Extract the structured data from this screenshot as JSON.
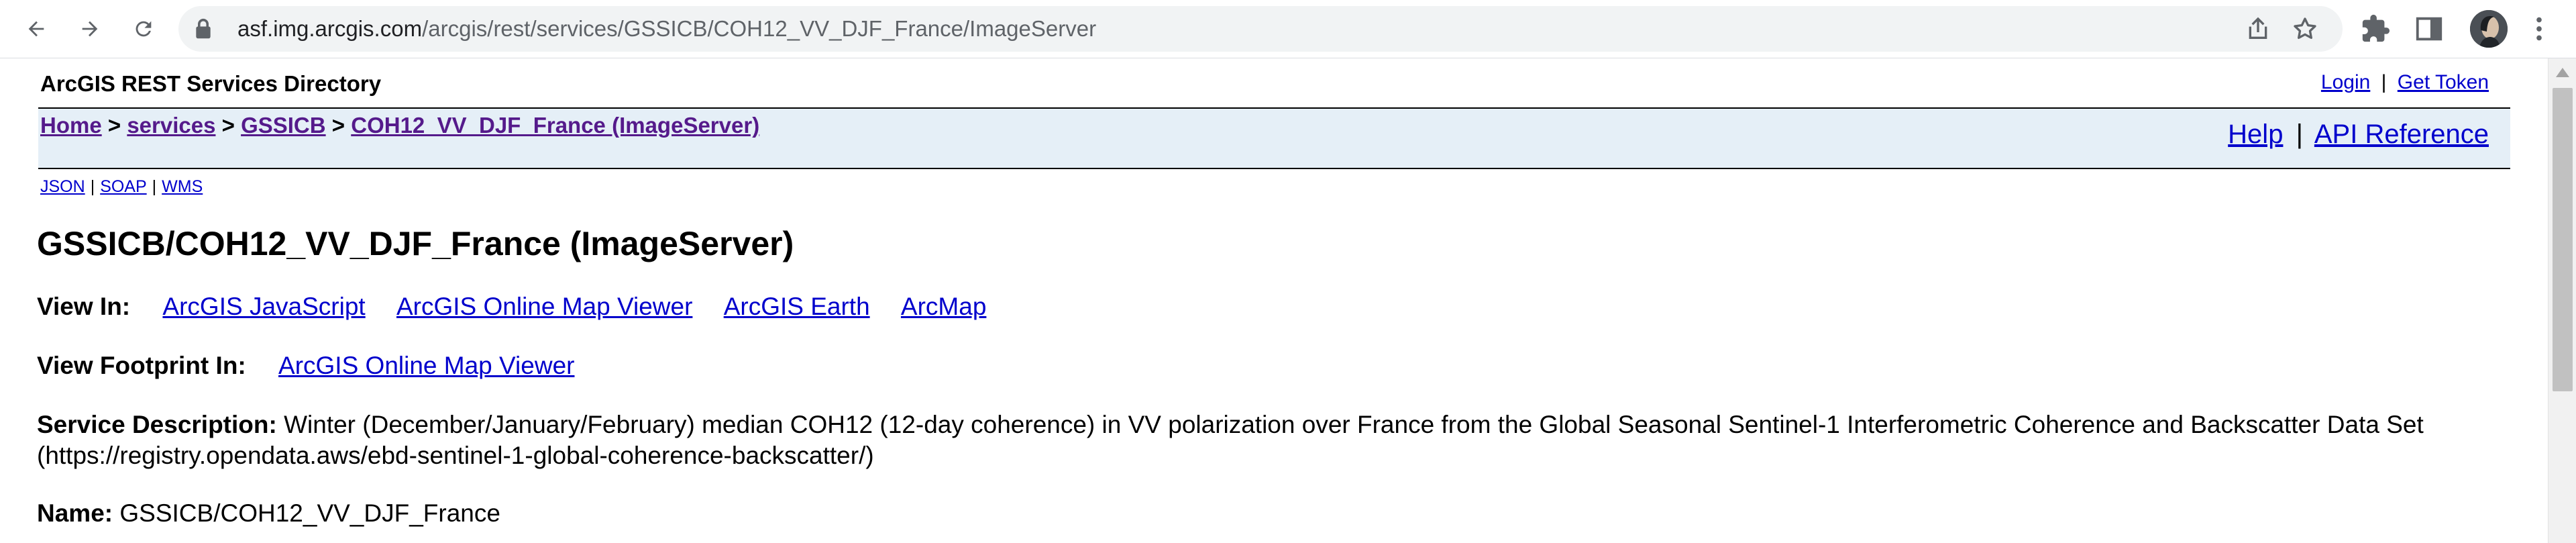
{
  "browser": {
    "url_host": "asf.img.arcgis.com",
    "url_path": "/arcgis/rest/services/GSSICB/COH12_VV_DJF_France/ImageServer",
    "icons": [
      "back-icon",
      "forward-icon",
      "reload-icon",
      "lock-icon",
      "share-icon",
      "star-icon",
      "extensions-icon",
      "sidepanel-icon",
      "profile-avatar",
      "menu-icon"
    ]
  },
  "header": {
    "title": "ArcGIS REST Services Directory",
    "login": "Login",
    "get_token": "Get Token",
    "sep": "|"
  },
  "breadcrumb": {
    "home": "Home",
    "services": "services",
    "folder": "GSSICB",
    "current": "COH12_VV_DJF_France (ImageServer)",
    "gt": ">"
  },
  "help": {
    "help": "Help",
    "api": "API Reference"
  },
  "formats": {
    "json": "JSON",
    "soap": "SOAP",
    "wms": "WMS"
  },
  "main": {
    "heading": "GSSICB/COH12_VV_DJF_France (ImageServer)",
    "view_in_label": "View In:",
    "view_in_links": [
      "ArcGIS JavaScript",
      "ArcGIS Online Map Viewer",
      "ArcGIS Earth",
      "ArcMap"
    ],
    "footprint_label": "View Footprint In:",
    "footprint_link": "ArcGIS Online Map Viewer",
    "desc_label": "Service Description:",
    "desc_text": "Winter (December/January/February) median COH12 (12-day coherence) in VV polarization over France from the Global Seasonal Sentinel-1 Interferometric Coherence and Backscatter Data Set (https://registry.opendata.aws/ebd-sentinel-1-global-coherence-backscatter/)",
    "name_label": "Name:",
    "name_value": "GSSICB/COH12_VV_DJF_France"
  },
  "colors": {
    "nav_band": "#e5eff7",
    "link": "#0000cc",
    "visited": "#551a8b"
  }
}
